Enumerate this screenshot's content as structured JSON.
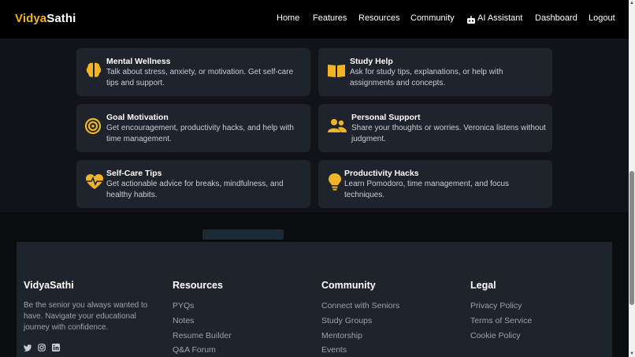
{
  "brand": {
    "part1": "Vidya",
    "part2": "Sathi"
  },
  "nav": [
    "Home",
    "Features",
    "Resources",
    "Community",
    "AI Assistant",
    "Dashboard",
    "Logout"
  ],
  "cards": [
    {
      "title": "Mental Wellness",
      "desc": "Talk about stress, anxiety, or motivation. Get self-care tips and support.",
      "icon": "brain-icon"
    },
    {
      "title": "Study Help",
      "desc": "Ask for study tips, explanations, or help with assignments and concepts.",
      "icon": "book-icon"
    },
    {
      "title": "Goal Motivation",
      "desc": "Get encouragement, productivity hacks, and help with time management.",
      "icon": "target-icon"
    },
    {
      "title": "Personal Support",
      "desc": "Share your thoughts or worries. Veronica listens without judgment.",
      "icon": "users-icon"
    },
    {
      "title": "Self-Care Tips",
      "desc": "Get actionable advice for breaks, mindfulness, and healthy habits.",
      "icon": "heartbeat-icon"
    },
    {
      "title": "Productivity Hacks",
      "desc": "Learn Pomodoro, time management, and focus techniques.",
      "icon": "lightbulb-icon"
    }
  ],
  "footer": {
    "brand": "VidyaSathi",
    "tagline": "Be the senior you always wanted to have. Navigate your educational journey with confidence.",
    "resources": {
      "title": "Resources",
      "links": [
        "PYQs",
        "Notes",
        "Resume Builder",
        "Q&A Forum"
      ]
    },
    "community": {
      "title": "Community",
      "links": [
        "Connect with Seniors",
        "Study Groups",
        "Mentorship",
        "Events"
      ]
    },
    "legal": {
      "title": "Legal",
      "links": [
        "Privacy Policy",
        "Terms of Service",
        "Cookie Policy"
      ]
    },
    "social": [
      "twitter-icon",
      "instagram-icon",
      "linkedin-icon"
    ]
  },
  "colors": {
    "accent": "#f0b429",
    "card": "#1f232b",
    "bg": "#111318"
  }
}
